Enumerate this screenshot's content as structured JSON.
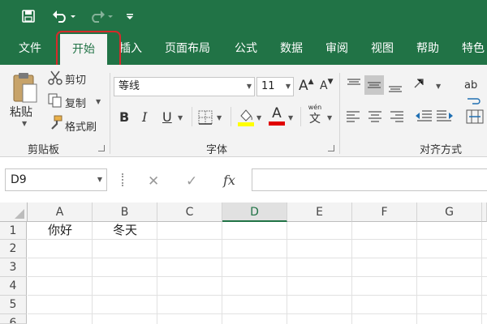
{
  "tabs": [
    "文件",
    "开始",
    "插入",
    "页面布局",
    "公式",
    "数据",
    "审阅",
    "视图",
    "帮助",
    "特色"
  ],
  "active_tab": "开始",
  "highlight_color": "#d62a2a",
  "theme_color": "#217346",
  "clipboard": {
    "paste": "粘贴",
    "cut": "剪切",
    "copy": "复制",
    "format_painter": "格式刷",
    "group": "剪贴板"
  },
  "font": {
    "name": "等线",
    "size": "11",
    "bold": "B",
    "italic": "I",
    "underline": "U",
    "font_color_glyph": "A",
    "pinyin_glyph": "文",
    "pinyin_top": "wén",
    "grow": "A",
    "shrink": "A",
    "group": "字体"
  },
  "alignment": {
    "group": "对齐方式",
    "wrap_glyph": "ab"
  },
  "formula_bar": {
    "name_box": "D9",
    "cancel": "✕",
    "enter": "✓",
    "fx": "fx",
    "value": ""
  },
  "sheet": {
    "columns": [
      "A",
      "B",
      "C",
      "D",
      "E",
      "F",
      "G"
    ],
    "selected_column": "D",
    "rows": [
      "1",
      "2",
      "3",
      "4",
      "5",
      "6"
    ],
    "cells": {
      "A1": "你好",
      "B1": "冬天"
    }
  },
  "icons": [
    "save-icon",
    "undo-icon",
    "redo-icon",
    "customize-qat-icon",
    "paste-icon",
    "cut-icon",
    "copy-icon",
    "format-painter-icon",
    "border-icon",
    "fill-color-icon",
    "font-color-icon",
    "pinyin-icon",
    "align-icons",
    "indent-icons",
    "wrap-text-icon",
    "merge-icon"
  ]
}
